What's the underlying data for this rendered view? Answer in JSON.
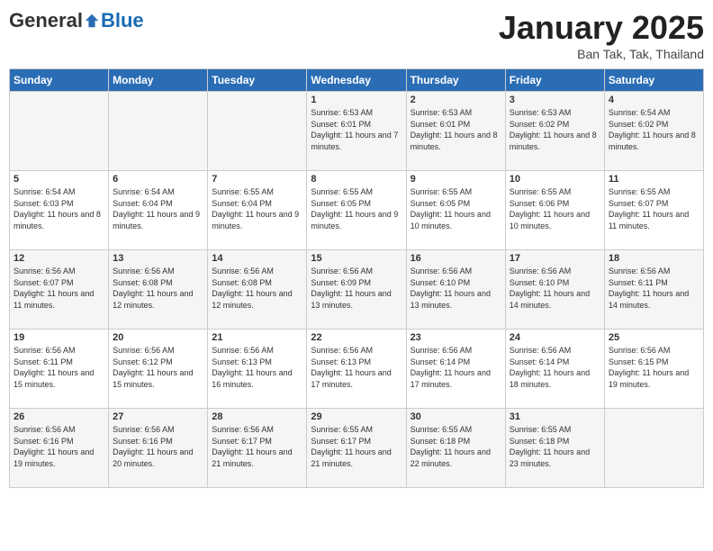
{
  "logo": {
    "general": "General",
    "blue": "Blue"
  },
  "title": "January 2025",
  "location": "Ban Tak, Tak, Thailand",
  "days_of_week": [
    "Sunday",
    "Monday",
    "Tuesday",
    "Wednesday",
    "Thursday",
    "Friday",
    "Saturday"
  ],
  "weeks": [
    [
      {
        "day": "",
        "sunrise": "",
        "sunset": "",
        "daylight": ""
      },
      {
        "day": "",
        "sunrise": "",
        "sunset": "",
        "daylight": ""
      },
      {
        "day": "",
        "sunrise": "",
        "sunset": "",
        "daylight": ""
      },
      {
        "day": "1",
        "sunrise": "Sunrise: 6:53 AM",
        "sunset": "Sunset: 6:01 PM",
        "daylight": "Daylight: 11 hours and 7 minutes."
      },
      {
        "day": "2",
        "sunrise": "Sunrise: 6:53 AM",
        "sunset": "Sunset: 6:01 PM",
        "daylight": "Daylight: 11 hours and 8 minutes."
      },
      {
        "day": "3",
        "sunrise": "Sunrise: 6:53 AM",
        "sunset": "Sunset: 6:02 PM",
        "daylight": "Daylight: 11 hours and 8 minutes."
      },
      {
        "day": "4",
        "sunrise": "Sunrise: 6:54 AM",
        "sunset": "Sunset: 6:02 PM",
        "daylight": "Daylight: 11 hours and 8 minutes."
      }
    ],
    [
      {
        "day": "5",
        "sunrise": "Sunrise: 6:54 AM",
        "sunset": "Sunset: 6:03 PM",
        "daylight": "Daylight: 11 hours and 8 minutes."
      },
      {
        "day": "6",
        "sunrise": "Sunrise: 6:54 AM",
        "sunset": "Sunset: 6:04 PM",
        "daylight": "Daylight: 11 hours and 9 minutes."
      },
      {
        "day": "7",
        "sunrise": "Sunrise: 6:55 AM",
        "sunset": "Sunset: 6:04 PM",
        "daylight": "Daylight: 11 hours and 9 minutes."
      },
      {
        "day": "8",
        "sunrise": "Sunrise: 6:55 AM",
        "sunset": "Sunset: 6:05 PM",
        "daylight": "Daylight: 11 hours and 9 minutes."
      },
      {
        "day": "9",
        "sunrise": "Sunrise: 6:55 AM",
        "sunset": "Sunset: 6:05 PM",
        "daylight": "Daylight: 11 hours and 10 minutes."
      },
      {
        "day": "10",
        "sunrise": "Sunrise: 6:55 AM",
        "sunset": "Sunset: 6:06 PM",
        "daylight": "Daylight: 11 hours and 10 minutes."
      },
      {
        "day": "11",
        "sunrise": "Sunrise: 6:55 AM",
        "sunset": "Sunset: 6:07 PM",
        "daylight": "Daylight: 11 hours and 11 minutes."
      }
    ],
    [
      {
        "day": "12",
        "sunrise": "Sunrise: 6:56 AM",
        "sunset": "Sunset: 6:07 PM",
        "daylight": "Daylight: 11 hours and 11 minutes."
      },
      {
        "day": "13",
        "sunrise": "Sunrise: 6:56 AM",
        "sunset": "Sunset: 6:08 PM",
        "daylight": "Daylight: 11 hours and 12 minutes."
      },
      {
        "day": "14",
        "sunrise": "Sunrise: 6:56 AM",
        "sunset": "Sunset: 6:08 PM",
        "daylight": "Daylight: 11 hours and 12 minutes."
      },
      {
        "day": "15",
        "sunrise": "Sunrise: 6:56 AM",
        "sunset": "Sunset: 6:09 PM",
        "daylight": "Daylight: 11 hours and 13 minutes."
      },
      {
        "day": "16",
        "sunrise": "Sunrise: 6:56 AM",
        "sunset": "Sunset: 6:10 PM",
        "daylight": "Daylight: 11 hours and 13 minutes."
      },
      {
        "day": "17",
        "sunrise": "Sunrise: 6:56 AM",
        "sunset": "Sunset: 6:10 PM",
        "daylight": "Daylight: 11 hours and 14 minutes."
      },
      {
        "day": "18",
        "sunrise": "Sunrise: 6:56 AM",
        "sunset": "Sunset: 6:11 PM",
        "daylight": "Daylight: 11 hours and 14 minutes."
      }
    ],
    [
      {
        "day": "19",
        "sunrise": "Sunrise: 6:56 AM",
        "sunset": "Sunset: 6:11 PM",
        "daylight": "Daylight: 11 hours and 15 minutes."
      },
      {
        "day": "20",
        "sunrise": "Sunrise: 6:56 AM",
        "sunset": "Sunset: 6:12 PM",
        "daylight": "Daylight: 11 hours and 15 minutes."
      },
      {
        "day": "21",
        "sunrise": "Sunrise: 6:56 AM",
        "sunset": "Sunset: 6:13 PM",
        "daylight": "Daylight: 11 hours and 16 minutes."
      },
      {
        "day": "22",
        "sunrise": "Sunrise: 6:56 AM",
        "sunset": "Sunset: 6:13 PM",
        "daylight": "Daylight: 11 hours and 17 minutes."
      },
      {
        "day": "23",
        "sunrise": "Sunrise: 6:56 AM",
        "sunset": "Sunset: 6:14 PM",
        "daylight": "Daylight: 11 hours and 17 minutes."
      },
      {
        "day": "24",
        "sunrise": "Sunrise: 6:56 AM",
        "sunset": "Sunset: 6:14 PM",
        "daylight": "Daylight: 11 hours and 18 minutes."
      },
      {
        "day": "25",
        "sunrise": "Sunrise: 6:56 AM",
        "sunset": "Sunset: 6:15 PM",
        "daylight": "Daylight: 11 hours and 19 minutes."
      }
    ],
    [
      {
        "day": "26",
        "sunrise": "Sunrise: 6:56 AM",
        "sunset": "Sunset: 6:16 PM",
        "daylight": "Daylight: 11 hours and 19 minutes."
      },
      {
        "day": "27",
        "sunrise": "Sunrise: 6:56 AM",
        "sunset": "Sunset: 6:16 PM",
        "daylight": "Daylight: 11 hours and 20 minutes."
      },
      {
        "day": "28",
        "sunrise": "Sunrise: 6:56 AM",
        "sunset": "Sunset: 6:17 PM",
        "daylight": "Daylight: 11 hours and 21 minutes."
      },
      {
        "day": "29",
        "sunrise": "Sunrise: 6:55 AM",
        "sunset": "Sunset: 6:17 PM",
        "daylight": "Daylight: 11 hours and 21 minutes."
      },
      {
        "day": "30",
        "sunrise": "Sunrise: 6:55 AM",
        "sunset": "Sunset: 6:18 PM",
        "daylight": "Daylight: 11 hours and 22 minutes."
      },
      {
        "day": "31",
        "sunrise": "Sunrise: 6:55 AM",
        "sunset": "Sunset: 6:18 PM",
        "daylight": "Daylight: 11 hours and 23 minutes."
      },
      {
        "day": "",
        "sunrise": "",
        "sunset": "",
        "daylight": ""
      }
    ]
  ]
}
